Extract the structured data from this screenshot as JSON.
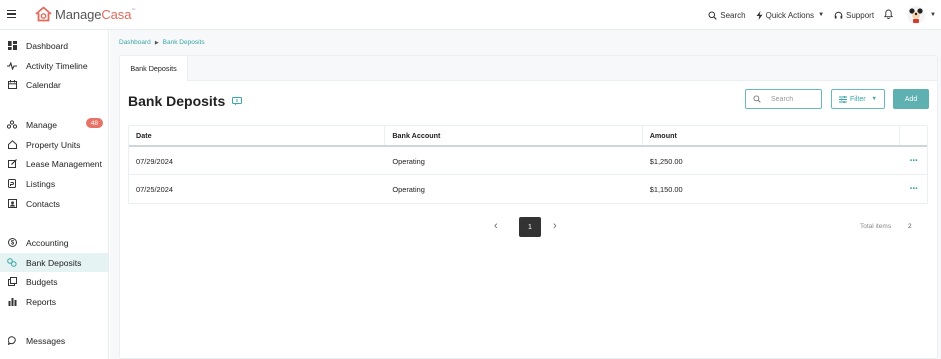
{
  "app": {
    "logo_part1": "Manage",
    "logo_part2": "Casa",
    "logo_tm": "™",
    "brand_color": "#e06b5d",
    "accent_color": "#3aa6a6"
  },
  "topbar": {
    "search_label": "Search",
    "quick_actions_label": "Quick Actions",
    "support_label": "Support"
  },
  "sidebar": {
    "items": [
      {
        "label": "Dashboard",
        "icon": "dashboard-icon"
      },
      {
        "label": "Activity Timeline",
        "icon": "pulse-icon"
      },
      {
        "label": "Calendar",
        "icon": "calendar-icon"
      },
      {
        "label": "Manage",
        "icon": "manage-icon",
        "badge": "48"
      },
      {
        "label": "Property Units",
        "icon": "home-icon"
      },
      {
        "label": "Lease Management",
        "icon": "edit-icon"
      },
      {
        "label": "Listings",
        "icon": "listing-icon"
      },
      {
        "label": "Contacts",
        "icon": "contacts-icon"
      },
      {
        "label": "Accounting",
        "icon": "dollar-icon"
      },
      {
        "label": "Bank Deposits",
        "icon": "bank-deposit-icon",
        "active": true
      },
      {
        "label": "Budgets",
        "icon": "budget-icon"
      },
      {
        "label": "Reports",
        "icon": "reports-icon"
      },
      {
        "label": "Messages",
        "icon": "message-icon"
      }
    ]
  },
  "breadcrumb": {
    "root": "Dashboard",
    "current": "Bank Deposits"
  },
  "tab": {
    "label": "Bank Deposits"
  },
  "page": {
    "title": "Bank Deposits",
    "search_placeholder": "Search",
    "filter_label": "Filter",
    "add_label": "Add"
  },
  "table": {
    "headers": [
      "Date",
      "Bank Account",
      "Amount"
    ],
    "rows": [
      {
        "date": "07/29/2024",
        "account": "Operating",
        "amount": "$1,250.00",
        "more": "···"
      },
      {
        "date": "07/25/2024",
        "account": "Operating",
        "amount": "$1,150.00",
        "more": "···"
      }
    ]
  },
  "pagination": {
    "prev": "‹",
    "current": "1",
    "next": "›",
    "total_label": "Total items",
    "total_value": "2"
  }
}
